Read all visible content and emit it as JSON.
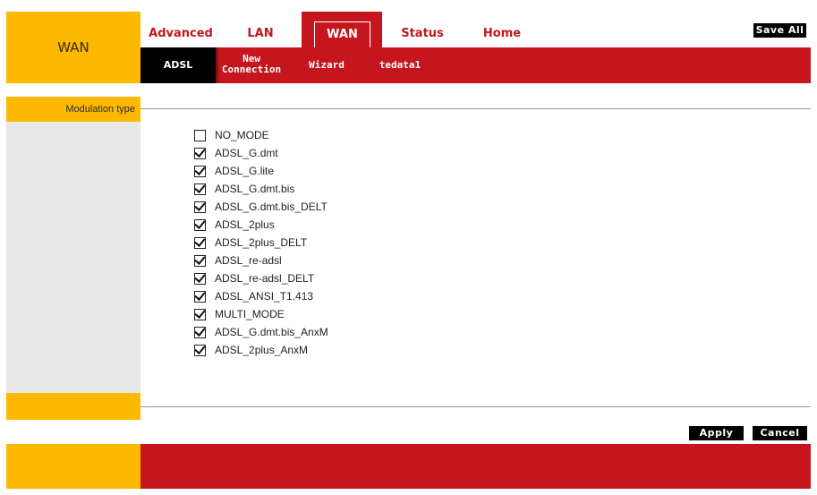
{
  "header": {
    "section_title": "WAN",
    "tabs": [
      {
        "label": "Advanced"
      },
      {
        "label": "LAN"
      },
      {
        "label": "WAN"
      },
      {
        "label": "Status"
      },
      {
        "label": "Home"
      }
    ],
    "save_all_label": "Save All"
  },
  "subnav": {
    "items": [
      {
        "label": "ADSL"
      },
      {
        "label_line1": "New",
        "label_line2": "Connection"
      },
      {
        "label": "Wizard"
      },
      {
        "label": "tedata1"
      }
    ]
  },
  "modulation": {
    "label": "Modulation type",
    "modes": [
      {
        "label": "NO_MODE",
        "checked": false
      },
      {
        "label": "ADSL_G.dmt",
        "checked": true
      },
      {
        "label": "ADSL_G.lite",
        "checked": true
      },
      {
        "label": "ADSL_G.dmt.bis",
        "checked": true
      },
      {
        "label": "ADSL_G.dmt.bis_DELT",
        "checked": true
      },
      {
        "label": "ADSL_2plus",
        "checked": true
      },
      {
        "label": "ADSL_2plus_DELT",
        "checked": true
      },
      {
        "label": "ADSL_re-adsl",
        "checked": true
      },
      {
        "label": "ADSL_re-adsl_DELT",
        "checked": true
      },
      {
        "label": "ADSL_ANSI_T1.413",
        "checked": true
      },
      {
        "label": "MULTI_MODE",
        "checked": true
      },
      {
        "label": "ADSL_G.dmt.bis_AnxM",
        "checked": true
      },
      {
        "label": "ADSL_2plus_AnxM",
        "checked": true
      }
    ]
  },
  "actions": {
    "apply_label": "Apply",
    "cancel_label": "Cancel"
  },
  "colors": {
    "accent_red": "#c4161c",
    "accent_yellow": "#fcb900",
    "sidebar_grey": "#e8e8e8"
  }
}
